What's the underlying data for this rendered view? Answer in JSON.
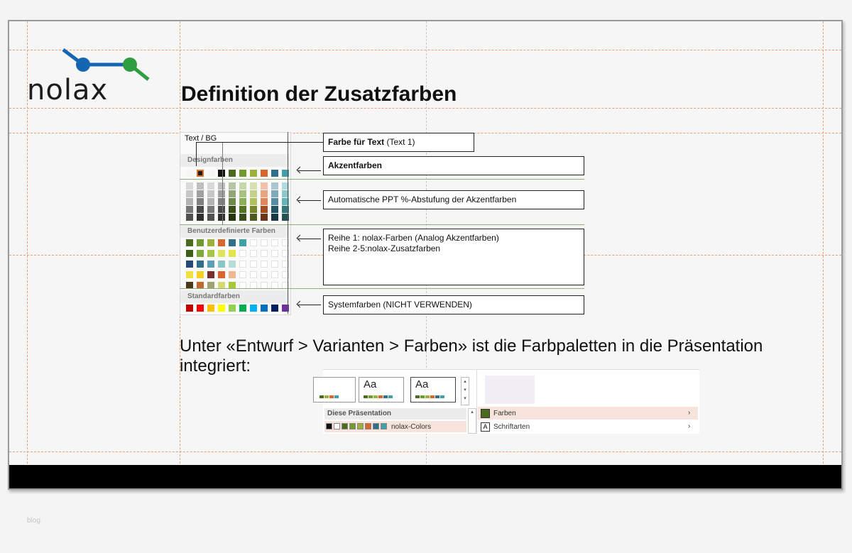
{
  "brand": {
    "logo_text": "nolax",
    "blue": "#1565b0",
    "green": "#2e9e3e"
  },
  "slide": {
    "title": "Definition der Zusatzfarben",
    "body": "Unter «Entwurf > Varianten > Farben» ist die Farbpaletten in die Präsentation integriert:"
  },
  "palette": {
    "text_bg_label": "Text / BG",
    "design_heading": "Designfarben",
    "custom_heading": "Benutzerdefinierte Farben",
    "standard_heading": "Standardfarben",
    "accent_colors": [
      "#f6f6f6",
      "#1a1a1a",
      "#f6f6f6",
      "#111111",
      "#4a6b1e",
      "#6f9a2e",
      "#9ab23a",
      "#d9652d",
      "#2f6f8a",
      "#3fa1a6"
    ],
    "standard_colors": [
      "#c00000",
      "#ff0000",
      "#ffc000",
      "#ffff00",
      "#92d050",
      "#00b050",
      "#00b0f0",
      "#0070c0",
      "#002060",
      "#7030a0"
    ]
  },
  "callouts": {
    "text_color_bold": "Farbe für Text",
    "text_color_rest": " (Text 1)",
    "accent": "Akzentfarben",
    "gradation": "Automatische PPT %-Abstufung der Akzentfarben",
    "custom_line1": "Reihe 1: nolax-Farben (Analog Akzentfarben)",
    "custom_line2": "Reihe 2-5:nolax-Zusatzfarben",
    "system": "Systemfarben (NICHT VERWENDEN)"
  },
  "ribbon": {
    "thumb_label": "Aa",
    "section_label": "Diese Präsentation",
    "theme_name": "nolax-Colors",
    "menu_colors": "Farben",
    "menu_fonts": "Schriftarten"
  },
  "watermark": "blog"
}
